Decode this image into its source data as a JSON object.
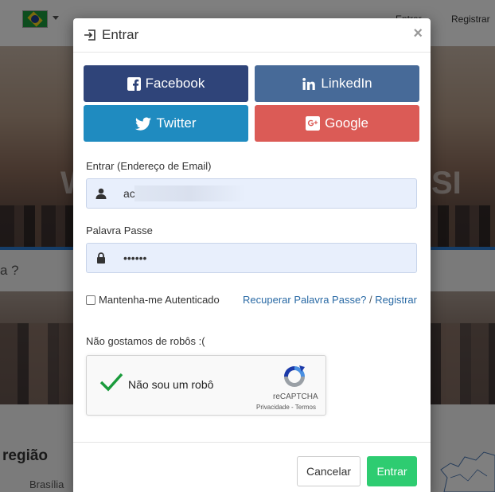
{
  "background": {
    "login_link": "Entrar",
    "register_link": "Registrar",
    "hero_text_left": "W",
    "hero_text_right": "SI",
    "search_text": "a ?",
    "region_heading": "região",
    "region_item": "Brasília",
    "flag_icon": "brazil-flag-icon"
  },
  "modal": {
    "title": "Entrar",
    "title_icon": "sign-in-icon",
    "close_label": "×",
    "social": {
      "facebook": "Facebook",
      "linkedin": "LinkedIn",
      "twitter": "Twitter",
      "google": "Google"
    },
    "email": {
      "label": "Entrar (Endereço de Email)",
      "value": "ac"
    },
    "password": {
      "label": "Palavra Passe",
      "value": "••••••"
    },
    "remember_label": "Mantenha-me Autenticado",
    "recover_link": "Recuperar Palavra Passe?",
    "separator": " / ",
    "register_link": "Registrar",
    "robots_label": "Não gostamos de robôs :(",
    "captcha": {
      "checkbox_label": "Não sou um robô",
      "brand": "reCAPTCHA",
      "terms": "Privacidade - Termos"
    },
    "cancel_button": "Cancelar",
    "submit_button": "Entrar"
  },
  "colors": {
    "facebook": "#2f4479",
    "linkedin": "#476a98",
    "twitter": "#1f8bc0",
    "google": "#db5b56",
    "submit": "#2ecc71",
    "link": "#2a6aa5"
  }
}
